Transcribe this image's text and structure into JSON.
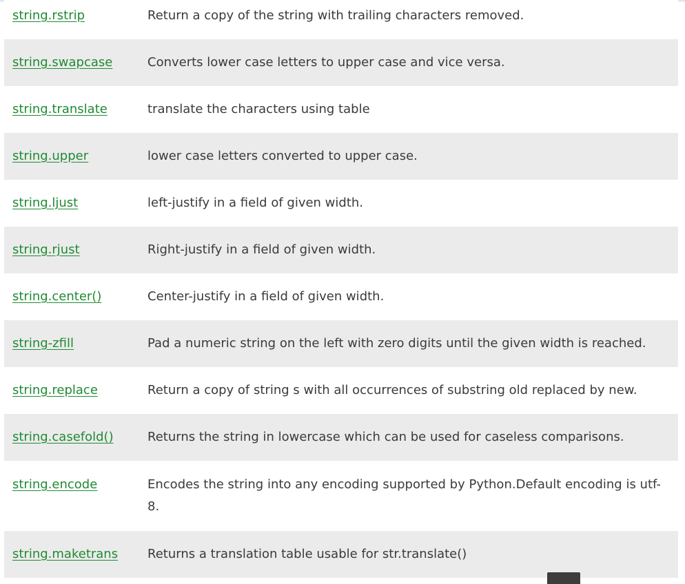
{
  "table": {
    "rows": [
      {
        "name": "string.rstrip",
        "description": "Return a copy of the string with trailing characters removed."
      },
      {
        "name": "string.swapcase",
        "description": "Converts lower case letters to upper case and vice versa."
      },
      {
        "name": "string.translate",
        "description": "translate the characters using table"
      },
      {
        "name": "string.upper",
        "description": "lower case letters converted to upper case."
      },
      {
        "name": "string.ljust",
        "description": "left-justify in a field of given width."
      },
      {
        "name": "string.rjust",
        "description": "Right-justify in a field of given width."
      },
      {
        "name": "string.center()",
        "description": "Center-justify in a field of given width."
      },
      {
        "name": "string-zfill",
        "description": "Pad a numeric string on the left with zero digits until the given width is reached."
      },
      {
        "name": "string.replace",
        "description": "Return a copy of string s with all occurrences of substring old replaced by new."
      },
      {
        "name": "string.casefold()",
        "description": "Returns the string in lowercase which can be used for caseless comparisons."
      },
      {
        "name": "string.encode",
        "description": "Encodes the string into any encoding supported by Python.Default encoding is utf-8."
      },
      {
        "name": "string.maketrans",
        "description": "Returns a translation table usable for str.translate()"
      }
    ]
  },
  "colors": {
    "link": "#1f8a32",
    "row_alt": "#ebebeb",
    "text": "#3a3a3a",
    "scroll_button": "#3d3d3d"
  },
  "icons": {
    "scroll_top": "scroll-to-top-icon"
  }
}
